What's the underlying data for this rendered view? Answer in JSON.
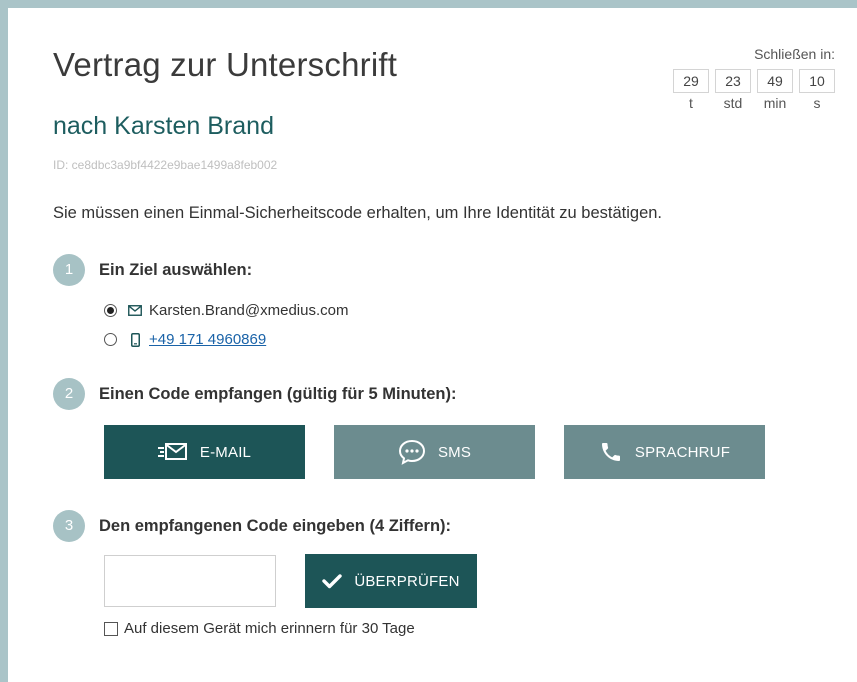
{
  "header": {
    "title": "Vertrag zur Unterschrift",
    "subtitle": "nach Karsten Brand",
    "doc_id": "ID: ce8dbc3a9bf4422e9bae1499a8feb002"
  },
  "countdown": {
    "label": "Schließen in:",
    "values": [
      "29",
      "23",
      "49",
      "10"
    ],
    "units": [
      "t",
      "std",
      "min",
      "s"
    ]
  },
  "intro": "Sie müssen einen Einmal-Sicherheitscode erhalten, um Ihre Identität zu bestätigen.",
  "steps": [
    {
      "num": "1",
      "label": "Ein Ziel auswählen:"
    },
    {
      "num": "2",
      "label": "Einen Code empfangen (gültig für 5 Minuten):"
    },
    {
      "num": "3",
      "label": "Den empfangenen Code eingeben (4 Ziffern):"
    }
  ],
  "destinations": [
    {
      "icon": "envelope-icon",
      "value": "Karsten.Brand@xmedius.com",
      "selected": true
    },
    {
      "icon": "mobile-phone-icon",
      "value": "+49 171 4960869",
      "selected": false
    }
  ],
  "channels": [
    {
      "icon": "email-send-icon",
      "label": "E-MAIL",
      "active": true
    },
    {
      "icon": "sms-bubble-icon",
      "label": "SMS",
      "active": false
    },
    {
      "icon": "phone-handset-icon",
      "label": "SPRACHRUF",
      "active": false
    }
  ],
  "code_input": {
    "value": "",
    "placeholder": ""
  },
  "verify_button": {
    "label": "ÜBERPRÜFEN",
    "icon": "checkmark-icon"
  },
  "remember": {
    "label": "Auf diesem Gerät mich erinnern für 30 Tage",
    "checked": false
  },
  "colors": {
    "accent_dark": "#1d5557",
    "accent_muted": "#6c8c8f",
    "step_circle": "#a7c2c5",
    "subtitle": "#1d5d5f",
    "link": "#1a63a8",
    "frame": "#aac4c8"
  }
}
